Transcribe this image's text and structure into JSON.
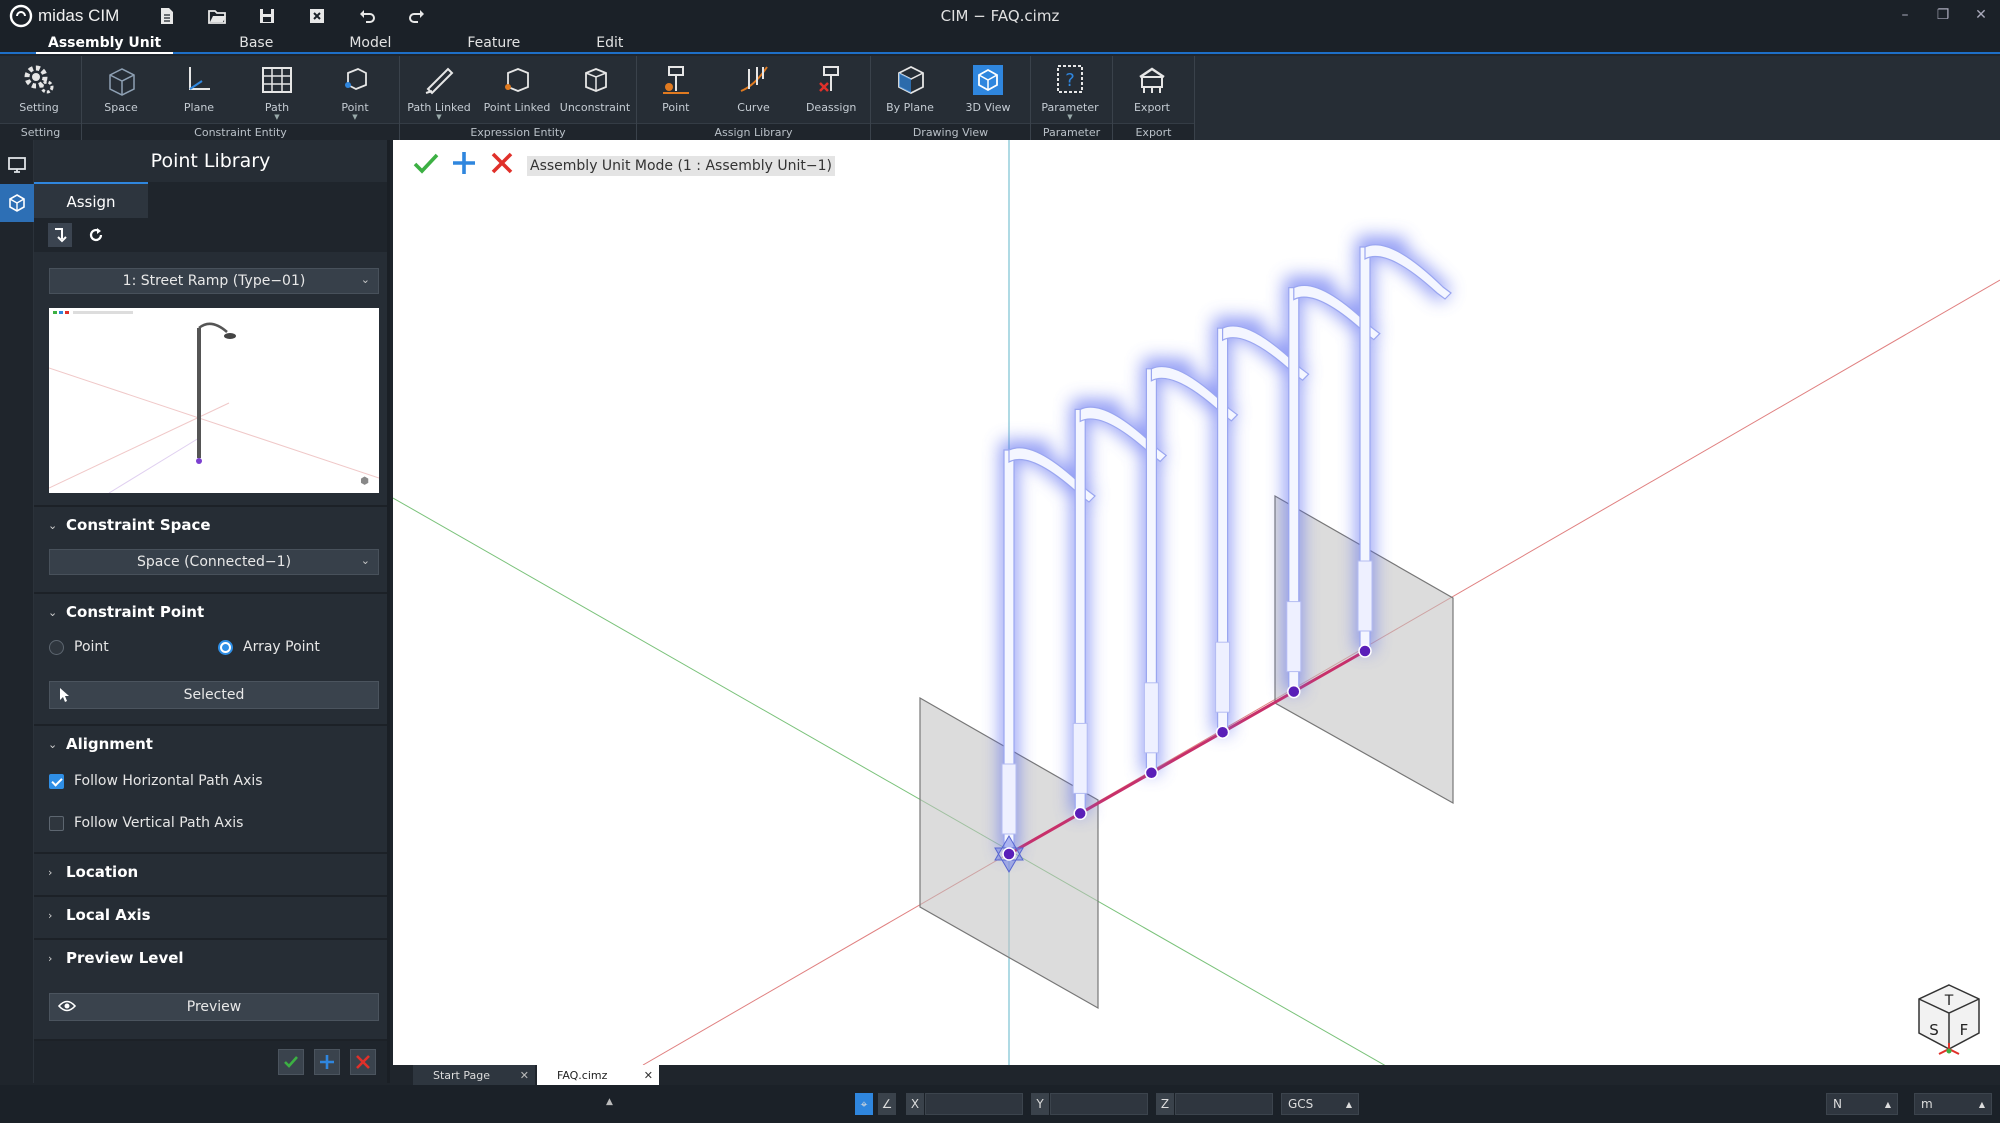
{
  "app": {
    "name": "midas CIM",
    "window_title": "CIM − FAQ.cimz"
  },
  "menu_tabs": [
    "Assembly Unit",
    "Base",
    "Model",
    "Feature",
    "Edit"
  ],
  "ribbon": {
    "groups": [
      {
        "label": "Setting",
        "buttons": [
          "Setting"
        ]
      },
      {
        "label": "Constraint Entity",
        "buttons": [
          "Space",
          "Plane",
          "Path",
          "Point"
        ]
      },
      {
        "label": "Expression Entity",
        "buttons": [
          "Path Linked",
          "Point Linked",
          "Unconstraint"
        ]
      },
      {
        "label": "Assign Library",
        "buttons": [
          "Point",
          "Curve",
          "Deassign"
        ]
      },
      {
        "label": "Drawing View",
        "buttons": [
          "By Plane",
          "3D View"
        ]
      },
      {
        "label": "Parameter",
        "buttons": [
          "Parameter"
        ]
      },
      {
        "label": "Export",
        "buttons": [
          "Export"
        ]
      }
    ]
  },
  "panel": {
    "title": "Point Library",
    "tab": "Assign",
    "library_select": "1: Street Ramp (Type−01)",
    "constraint_space": {
      "label": "Constraint Space",
      "value": "Space (Connected−1)"
    },
    "constraint_point": {
      "label": "Constraint Point",
      "opt_point": "Point",
      "opt_array": "Array Point",
      "selected_btn": "Selected"
    },
    "alignment": {
      "label": "Alignment",
      "horizontal": "Follow Horizontal Path Axis",
      "vertical": "Follow Vertical Path Axis"
    },
    "location": "Location",
    "local_axis": "Local Axis",
    "preview_level": "Preview Level",
    "preview_btn": "Preview"
  },
  "viewport": {
    "mode_label": "Assembly Unit Mode (1 : Assembly Unit−1)",
    "viewcube": {
      "top": "T",
      "left": "S",
      "right": "F"
    }
  },
  "doc_tabs": [
    "Start Page",
    "FAQ.cimz"
  ],
  "status": {
    "x_label": "X",
    "y_label": "Y",
    "z_label": "Z",
    "x_val": "",
    "y_val": "",
    "z_val": "",
    "coord_sys": "GCS",
    "force_unit": "N",
    "length_unit": "m"
  },
  "colors": {
    "accent": "#2f86de",
    "ok": "#3cb043",
    "cancel": "#e0302a",
    "path": "#c8306a",
    "glow": "#5b6cf0"
  }
}
